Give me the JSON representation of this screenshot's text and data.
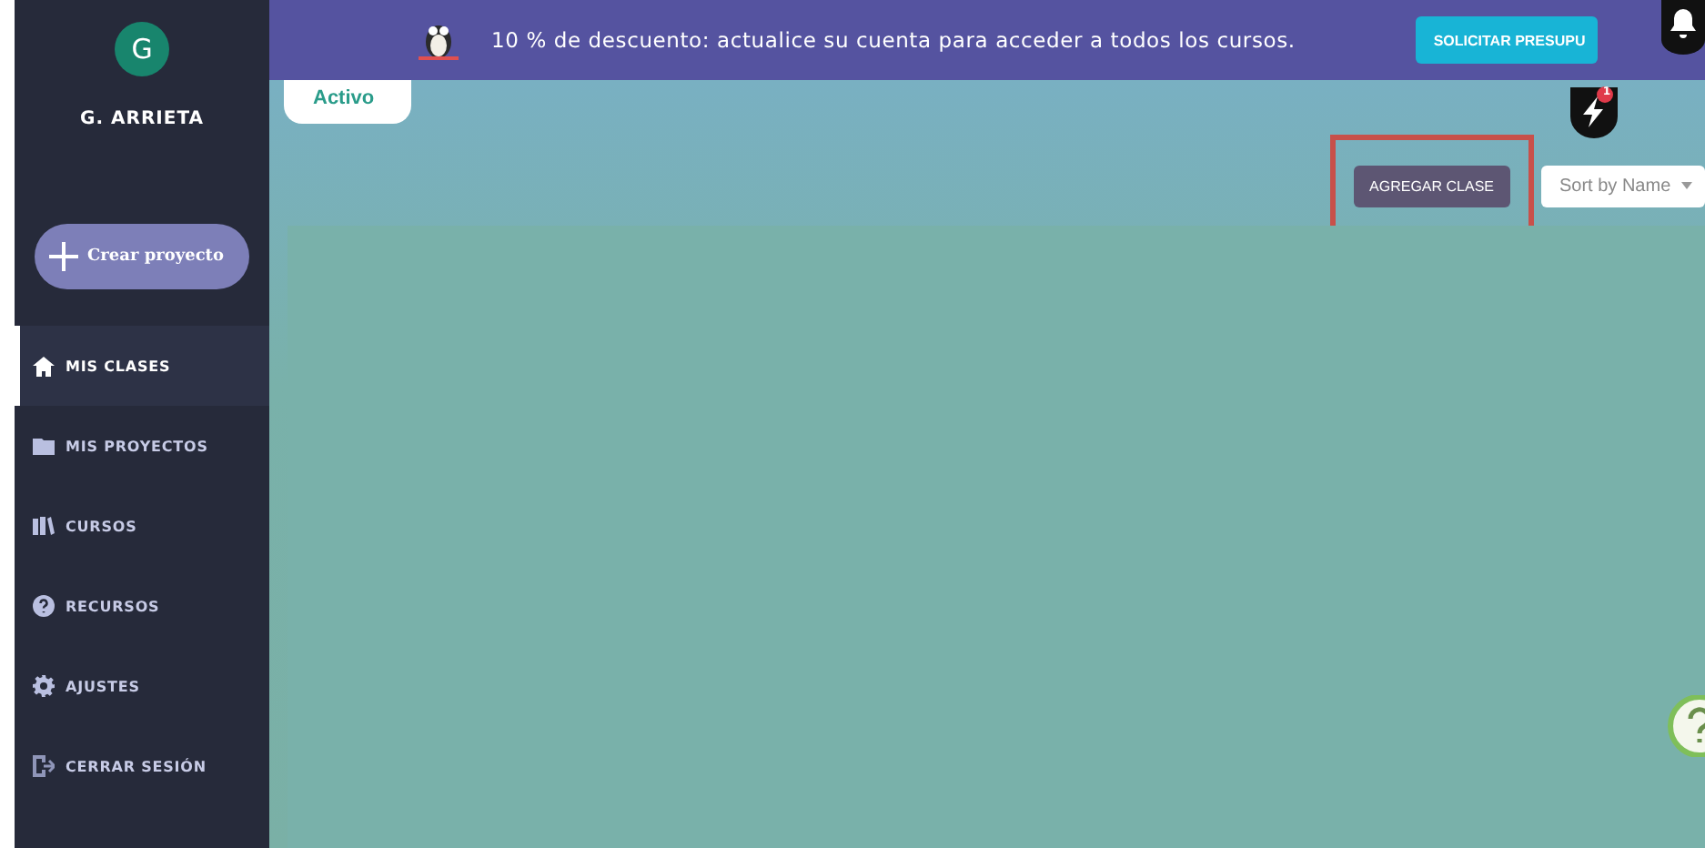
{
  "user": {
    "initial": "G",
    "name": "G. ARRIETA"
  },
  "create_button": {
    "label": "Crear proyecto"
  },
  "nav": [
    {
      "label": "MIS CLASES",
      "kind": "home",
      "selected": true
    },
    {
      "label": "MIS PROYECTOS",
      "kind": "folder",
      "selected": false
    },
    {
      "label": "CURSOS",
      "kind": "books",
      "selected": false
    },
    {
      "label": "RECURSOS",
      "kind": "help",
      "selected": false
    },
    {
      "label": "AJUSTES",
      "kind": "gear",
      "selected": false
    },
    {
      "label": "CERRAR SESIÓN",
      "kind": "exit",
      "selected": false
    }
  ],
  "banner": {
    "text": "10 % de descuento: actualice su cuenta para acceder a todos los cursos.",
    "button": "SOLICITAR PRESUPU"
  },
  "tabs": [
    {
      "label": "Activo",
      "selected": true
    }
  ],
  "notifications": {
    "count": "1"
  },
  "toolbar": {
    "add_button": "AGREGAR CLASE",
    "highlighted": true,
    "sort": "Sort by Name"
  }
}
